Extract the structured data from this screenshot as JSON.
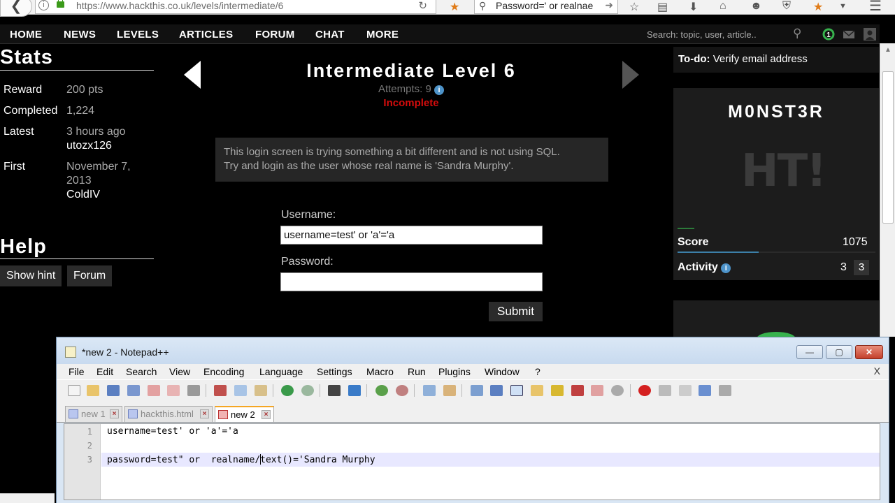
{
  "browser": {
    "url": "https://www.hackthis.co.uk/levels/intermediate/6",
    "search_value": "Password=' or realnae"
  },
  "nav": {
    "items": [
      "HOME",
      "NEWS",
      "LEVELS",
      "ARTICLES",
      "FORUM",
      "CHAT",
      "MORE"
    ],
    "search_placeholder": "Search: topic, user, article..",
    "notif_count": "1"
  },
  "stats": {
    "heading": "Stats",
    "rows": [
      {
        "label": "Reward",
        "value": "200 pts"
      },
      {
        "label": "Completed",
        "value": "1,224"
      },
      {
        "label": "Latest",
        "value": "3 hours ago",
        "user": "utozx126"
      },
      {
        "label": "First",
        "value": "November 7,",
        "value2": "2013",
        "user": "ColdIV"
      }
    ]
  },
  "help": {
    "heading": "Help",
    "buttons": [
      "Show hint",
      "Forum"
    ]
  },
  "level": {
    "title": "Intermediate Level 6",
    "attempts": "Attempts: 9",
    "status": "Incomplete",
    "status_color": "#d40c0c",
    "description_line1": "This login screen is trying something a bit different and is not using SQL.",
    "description_line2": "Try and login as the user whose real name is 'Sandra Murphy'."
  },
  "form": {
    "username_label": "Username:",
    "username_value": "username=test' or 'a'='a",
    "password_label": "Password:",
    "password_value": "",
    "submit_label": "Submit"
  },
  "sidebar": {
    "todo_label": "To-do:",
    "todo_text": "Verify email address",
    "profile_name": "M0NST3R",
    "logo_text": "HT!",
    "score_label": "Score",
    "score_value": "1075",
    "activity_label": "Activity",
    "activity_value": "3",
    "activity_badge": "3"
  },
  "notepad": {
    "title": "*new 2 - Notepad++",
    "menu": [
      "File",
      "Edit",
      "Search",
      "View",
      "Encoding",
      "Language",
      "Settings",
      "Macro",
      "Run",
      "Plugins",
      "Window",
      "?"
    ],
    "close_x": "X",
    "tabs": [
      {
        "label": "new 1"
      },
      {
        "label": "hackthis.html"
      },
      {
        "label": "new 2"
      }
    ],
    "lines": [
      {
        "num": "1",
        "text": "username=test' or 'a'='a"
      },
      {
        "num": "2",
        "text": ""
      },
      {
        "num": "3",
        "text_before_caret": "password=test\" or  realname/",
        "text_after_caret": "text()='Sandra Murphy"
      }
    ]
  }
}
